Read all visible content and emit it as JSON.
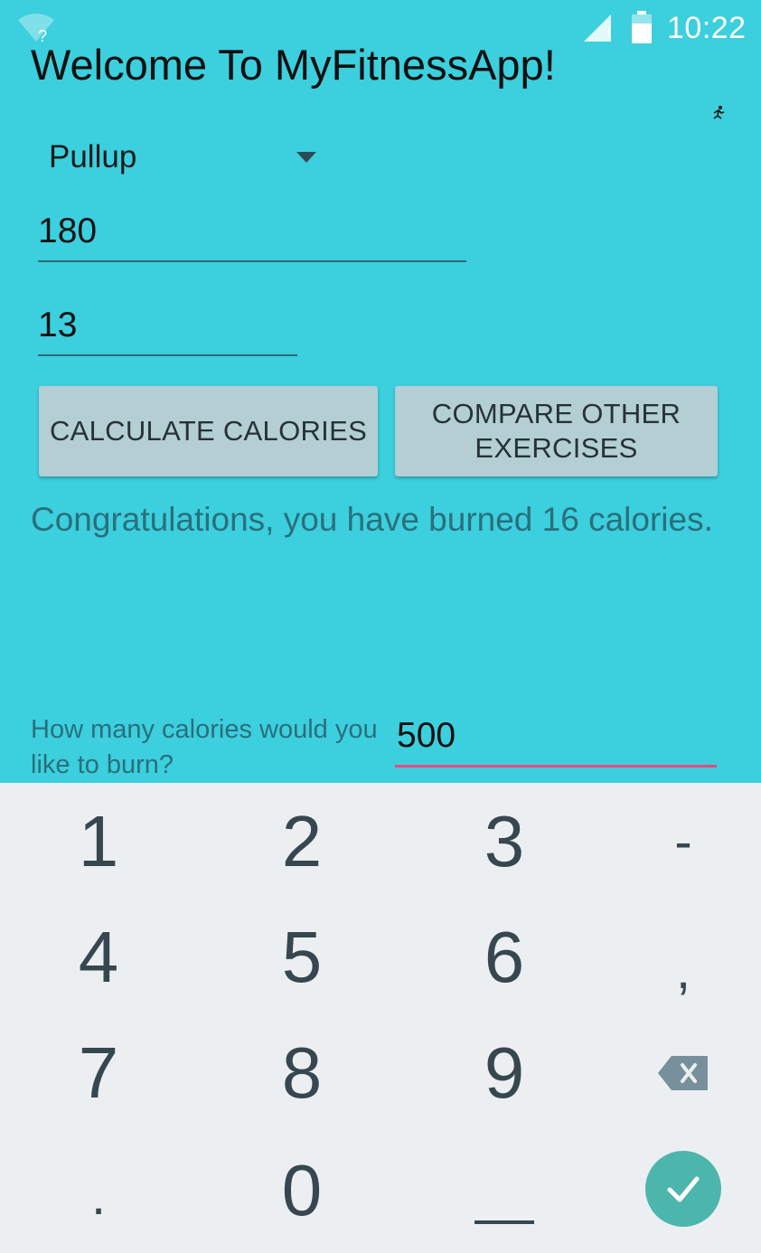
{
  "status_bar": {
    "time": "10:22",
    "icons": [
      "wifi-icon",
      "signal-icon",
      "battery-icon"
    ],
    "wifi_badge": "?",
    "signal_badge": "!"
  },
  "app": {
    "title": "Welcome To MyFitnessApp!",
    "exercise_select": {
      "selected": "Pullup"
    },
    "weight_field": {
      "value": "180"
    },
    "reps_field": {
      "value": "13"
    },
    "calculate_button": "CALCULATE CALORIES",
    "compare_button": "COMPARE OTHER EXERCISES",
    "result_text": "Congratulations, you have burned 16 calories.",
    "goal_label": "How many calories would you like to burn?",
    "goal_field": {
      "value": "500"
    }
  },
  "keyboard": {
    "keys": [
      "1",
      "2",
      "3",
      "-",
      "4",
      "5",
      "6",
      ",",
      "7",
      "8",
      "9",
      ".",
      "0"
    ],
    "special_keys": [
      "backspace-icon",
      "space-bar",
      "done-check-icon"
    ]
  },
  "colors": {
    "background": "#3ccfde",
    "button": "#b3cfd3",
    "accent_underline": "#e84a7e",
    "keyboard_bg": "#eceff1",
    "done_key": "#4db6ac"
  }
}
